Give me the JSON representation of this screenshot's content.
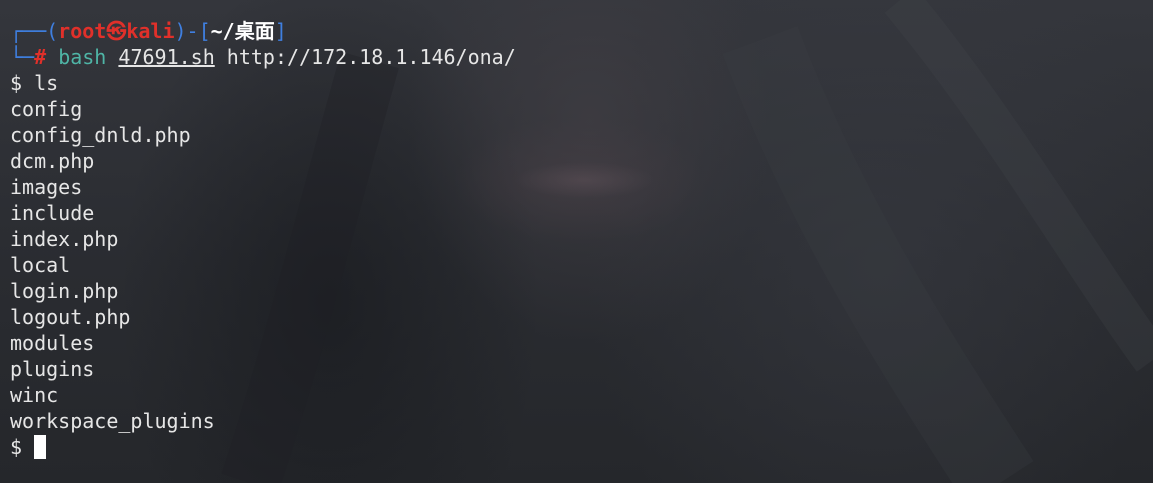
{
  "prompt": {
    "frame_top": "┌──(",
    "user": "root",
    "skull": "㉿",
    "host": "kali",
    "sep": ")-[",
    "cwd": "~/桌面",
    "close": "]",
    "frame_bottom": "└─",
    "hash": "#"
  },
  "command": {
    "program": "bash",
    "script": "47691.sh",
    "argument": "http://172.18.1.146/ona/"
  },
  "shell_prompt": "$",
  "ls_command": "ls",
  "ls_output": [
    "config",
    "config_dnld.php",
    "dcm.php",
    "images",
    "include",
    "index.php",
    "local",
    "login.php",
    "logout.php",
    "modules",
    "plugins",
    "winc",
    "workspace_plugins"
  ],
  "colors": {
    "prompt_frame": "#3f7fe0",
    "user_host": "#e0302a",
    "command": "#4fb5a6",
    "background": "#2b2d33"
  }
}
